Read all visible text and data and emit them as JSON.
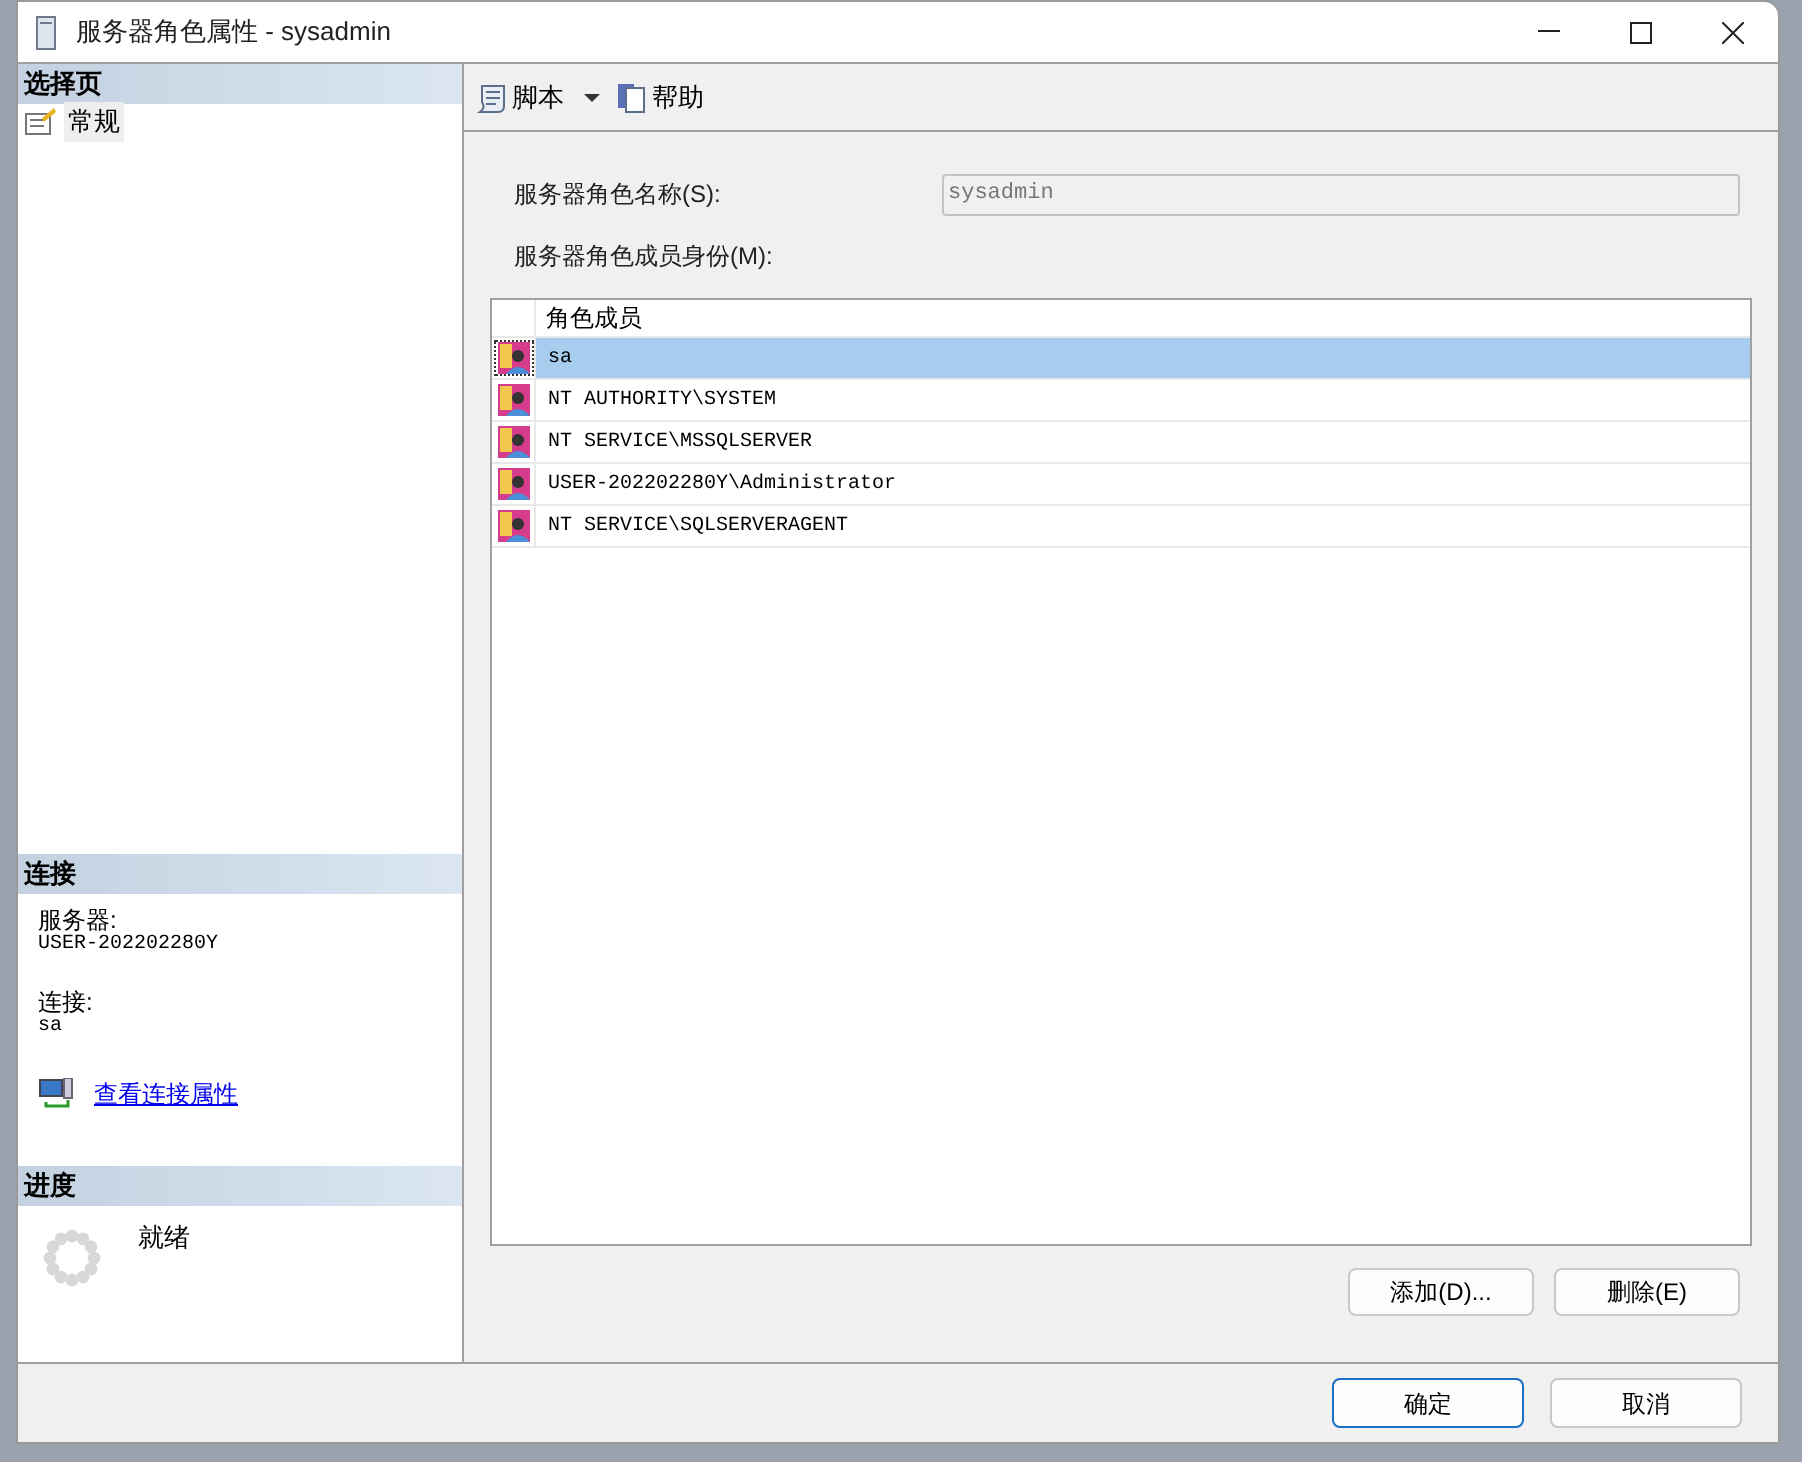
{
  "window": {
    "title": "服务器角色属性 - sysadmin"
  },
  "select_page": {
    "header": "选择页",
    "items": [
      {
        "label": "常规",
        "selected": true
      }
    ]
  },
  "connection": {
    "header": "连接",
    "server_label": "服务器:",
    "server": "USER-202202280Y",
    "connection_label": "连接:",
    "connection": "sa",
    "link": "查看连接属性"
  },
  "progress": {
    "header": "进度",
    "status": "就绪"
  },
  "toolbar": [
    {
      "label": "脚本",
      "kind": "dropdown"
    },
    {
      "label": "帮助",
      "kind": "help"
    }
  ],
  "role_name": {
    "label": "服务器角色名称(S):",
    "value": "sysadmin",
    "disabled": true
  },
  "members": {
    "label": "服务器角色成员身份(M):",
    "columns": [
      "角色成员"
    ],
    "rows": [
      {
        "name": "sa",
        "selected": true
      },
      {
        "name": "NT AUTHORITY\\SYSTEM",
        "selected": false
      },
      {
        "name": "NT SERVICE\\MSSQLSERVER",
        "selected": false
      },
      {
        "name": "USER-202202280Y\\Administrator",
        "selected": false
      },
      {
        "name": "NT SERVICE\\SQLSERVERAGENT",
        "selected": false
      }
    ]
  },
  "member_buttons": [
    "添加(D)...",
    "删除(E)"
  ],
  "dialog_buttons": [
    {
      "label": "确定",
      "default": true
    },
    {
      "label": "取消",
      "default": false
    }
  ]
}
